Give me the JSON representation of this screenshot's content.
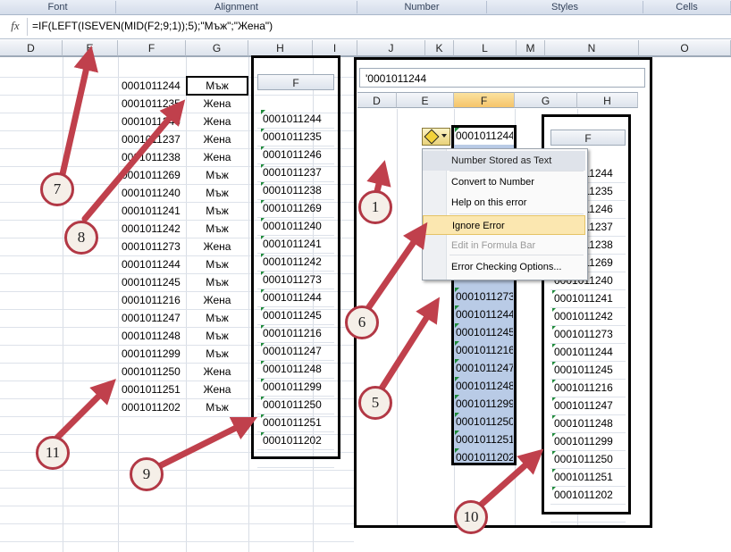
{
  "ribbon": {
    "groups": [
      "Font",
      "Alignment",
      "Number",
      "Styles",
      "Cells"
    ]
  },
  "formula_bar": {
    "fx": "fx",
    "formula": "=IF(LEFT(ISEVEN(MID(F2;9;1));5);\"Мъж\";\"Жена\")"
  },
  "columns_main": [
    "D",
    "E",
    "F",
    "G",
    "H",
    "I",
    "J",
    "K",
    "L",
    "M",
    "N",
    "O"
  ],
  "left_data": {
    "ids": [
      "0001011244",
      "0001011235",
      "0001011246",
      "0001011237",
      "0001011238",
      "0001011269",
      "0001011240",
      "0001011241",
      "0001011242",
      "0001011273",
      "0001011244",
      "0001011245",
      "0001011216",
      "0001011247",
      "0001011248",
      "0001011299",
      "0001011250",
      "0001011251",
      "0001011202"
    ],
    "genders": [
      "Мъж",
      "Жена",
      "Жена",
      "Жена",
      "Жена",
      "Мъж",
      "Мъж",
      "Мъж",
      "Мъж",
      "Жена",
      "Мъж",
      "Мъж",
      "Жена",
      "Мъж",
      "Мъж",
      "Мъж",
      "Жена",
      "Жена",
      "Мъж"
    ]
  },
  "inset_f": {
    "header": "F",
    "ids": [
      "0001011244",
      "0001011235",
      "0001011246",
      "0001011237",
      "0001011238",
      "0001011269",
      "0001011240",
      "0001011241",
      "0001011242",
      "0001011273",
      "0001011244",
      "0001011245",
      "0001011216",
      "0001011247",
      "0001011248",
      "0001011299",
      "0001011250",
      "0001011251",
      "0001011202"
    ]
  },
  "right_screenshot": {
    "formula": "'0001011244",
    "columns": [
      "D",
      "E",
      "F",
      "G",
      "H"
    ],
    "first_cell": "0001011244",
    "selected_ids": [
      "0001011273",
      "0001011244",
      "0001011245",
      "0001011216",
      "0001011247",
      "0001011248",
      "0001011299",
      "0001011250",
      "0001011251",
      "0001011202"
    ],
    "context_menu": [
      "Number Stored as Text",
      "Convert to Number",
      "Help on this error",
      "Ignore Error",
      "Edit in Formula Bar",
      "Error Checking Options..."
    ],
    "inset_header": "F",
    "inset_ids": [
      "0001011244",
      "0001011235",
      "0001011246",
      "0001011237",
      "0001011238",
      "0001011269",
      "0001011240",
      "0001011241",
      "0001011242",
      "0001011273",
      "0001011244",
      "0001011245",
      "0001011216",
      "0001011247",
      "0001011248",
      "0001011299",
      "0001011250",
      "0001011251",
      "0001011202"
    ]
  },
  "callouts": [
    "1",
    "5",
    "6",
    "7",
    "8",
    "9",
    "10",
    "11"
  ],
  "colors": {
    "callout_border": "#b23845",
    "arrow": "#c0404c",
    "selection": "#b9cbe6",
    "menu_highlight": "#fbe7b0"
  }
}
